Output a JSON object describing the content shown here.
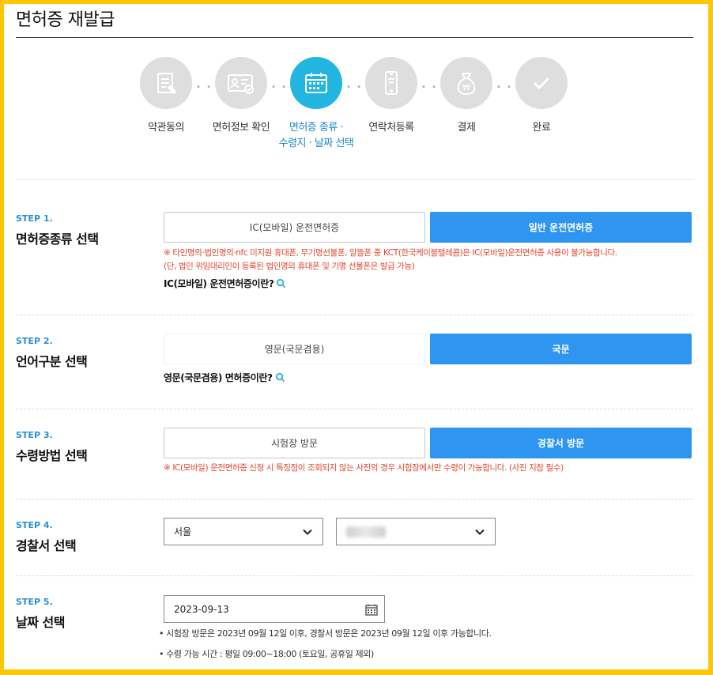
{
  "page": {
    "title": "면허증 재발급"
  },
  "progress": [
    {
      "label": "약관동의",
      "icon": "document-edit-icon"
    },
    {
      "label": "면허정보 확인",
      "icon": "id-card-check-icon"
    },
    {
      "label_line1": "면허증 종류 ·",
      "label_line2": "수령지 · 날짜 선택",
      "icon": "calendar-icon",
      "active": true
    },
    {
      "label": "연락처등록",
      "icon": "smartphone-icon"
    },
    {
      "label": "결제",
      "icon": "money-bag-won-icon"
    },
    {
      "label": "완료",
      "icon": "check-icon"
    }
  ],
  "step1": {
    "num": "STEP 1.",
    "heading": "면허증종류 선택",
    "option_a": "IC(모바일) 운전면허증",
    "option_b": "일반 운전면허증",
    "selected": "option_b",
    "warn1": "※ 타인명의·법인명의·nfc 미지원 휴대폰, 무기명선불폰, 알뜰폰 중 KCT(한국케이블텔레콤)은 IC(모바일)운전면허증 사용이 불가능합니다.",
    "warn2": "(단, 법인 위임대리인이 등록된 법인명의 휴대폰 및 기명 선불폰은 발급 가능)",
    "help": "IC(모바일) 운전면허증이란?"
  },
  "step2": {
    "num": "STEP 2.",
    "heading": "언어구분 선택",
    "option_a": "영문(국문겸용)",
    "option_b": "국문",
    "selected": "option_b",
    "help": "영문(국문겸용) 면허증이란?"
  },
  "step3": {
    "num": "STEP 3.",
    "heading": "수령방법 선택",
    "option_a": "시험장 방문",
    "option_b": "경찰서 방문",
    "selected": "option_b",
    "warn": "※ IC(모바일) 운전면허증 신청 시 특징점이 조회되지 않는 사진의 경우 시험장에서만 수령이 가능합니다. (사진 지참 필수)"
  },
  "step4": {
    "num": "STEP 4.",
    "heading": "경찰서 선택",
    "region": "서울",
    "station": ""
  },
  "step5": {
    "num": "STEP 5.",
    "heading": "날짜 선택",
    "date": "2023-09-13",
    "note1": "• 시험장 방문은 2023년 09월 12일 이후, 경찰서 방문은 2023년 09월 12일 이후 가능합니다.",
    "note2": "• 수령 가능 시간 : 평일 09:00~18:00 (토요일, 공휴일 제외)"
  },
  "colors": {
    "accent": "#2e96f0",
    "active_step": "#22b5e0",
    "warning": "#e2432b",
    "frame": "#ffc700"
  }
}
